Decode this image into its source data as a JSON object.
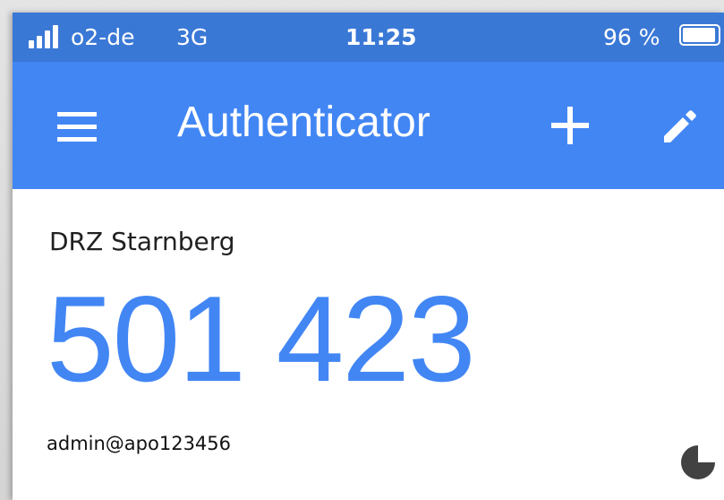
{
  "status_bar": {
    "carrier": "o2-de",
    "network": "3G",
    "time": "11:25",
    "battery_percent": "96 %",
    "battery_level": 0.96
  },
  "app_bar": {
    "title": "Authenticator",
    "icons": [
      "menu-icon",
      "add-icon",
      "edit-icon"
    ]
  },
  "account": {
    "issuer": "DRZ Starnberg",
    "code": "501 423",
    "name": "admin@apo123456",
    "timer_remaining_fraction": 0.75
  },
  "colors": {
    "status_bar": "#3a78d6",
    "app_bar": "#4286f4",
    "code": "#4286f4",
    "timer": "#424242"
  }
}
